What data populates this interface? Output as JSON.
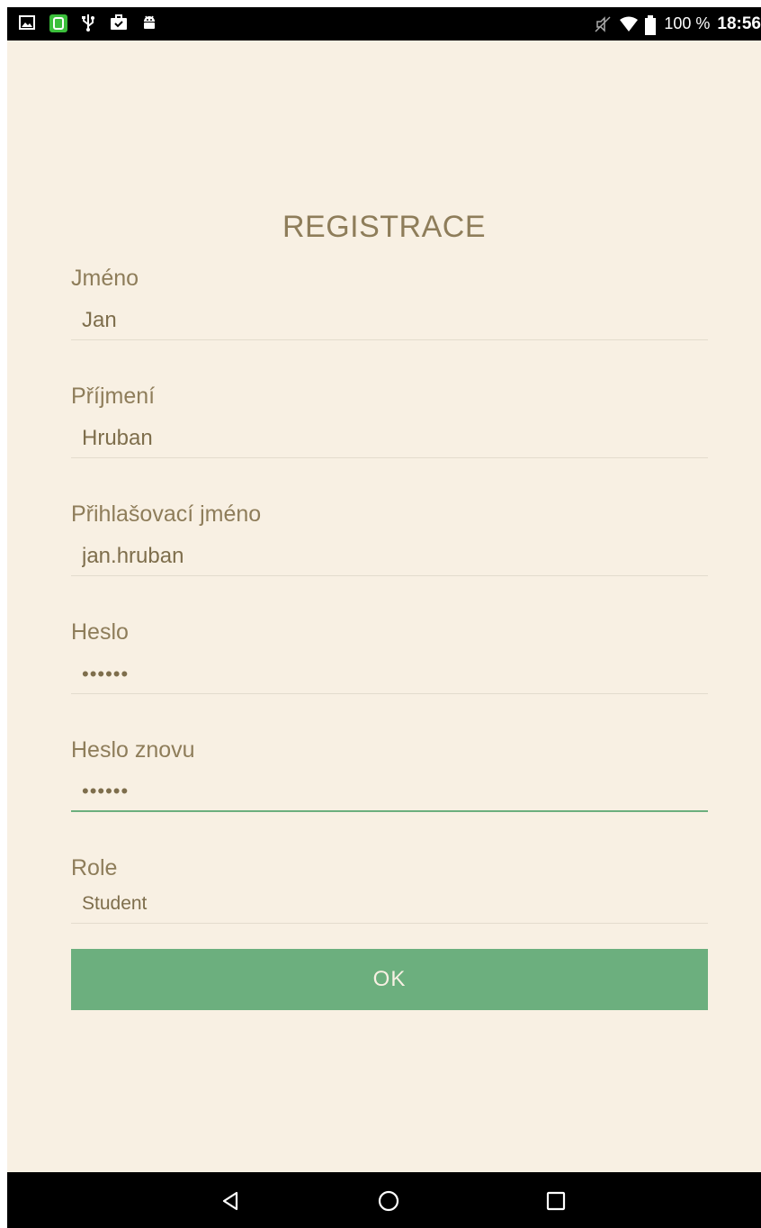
{
  "status_bar": {
    "battery_percent": "100 %",
    "time": "18:56",
    "left_icons": [
      "image-icon",
      "app-icon",
      "usb-icon",
      "briefcase-check-icon",
      "android-icon"
    ],
    "right_icons": [
      "mute-icon",
      "wifi-icon",
      "battery-icon"
    ]
  },
  "form": {
    "title": "REGISTRACE",
    "fields": [
      {
        "label": "Jméno",
        "value": "Jan"
      },
      {
        "label": "Příjmení",
        "value": "Hruban"
      },
      {
        "label": "Přihlašovací jméno",
        "value": "jan.hruban"
      },
      {
        "label": "Heslo",
        "value": "••••••"
      },
      {
        "label": "Heslo znovu",
        "value": "••••••"
      }
    ],
    "role": {
      "label": "Role",
      "value": "Student"
    },
    "ok_label": "OK"
  },
  "nav_bar": {
    "buttons": [
      "back-icon",
      "home-icon",
      "recents-icon"
    ]
  },
  "colors": {
    "background": "#f8f0e3",
    "accent": "#6caf7e",
    "text": "#8e7d5a"
  }
}
